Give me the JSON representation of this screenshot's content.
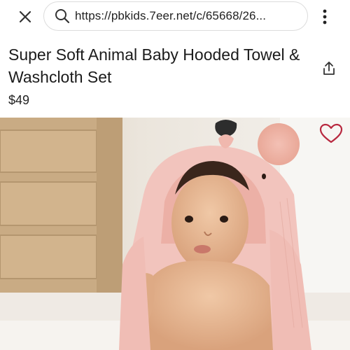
{
  "browser": {
    "url": "https://pbkids.7eer.net/c/65668/26...",
    "icons": {
      "close": "close-icon",
      "search": "search-icon",
      "menu": "more-vertical-icon"
    }
  },
  "product": {
    "title": "Super Soft Animal Baby Hooded Towel & Washcloth Set",
    "price": "$49",
    "icons": {
      "share": "share-icon",
      "favorite": "heart-outline-icon"
    }
  },
  "colors": {
    "accent_heart": "#b8283f",
    "towel_pink": "#f2c4bd",
    "text": "#1b1b1b"
  }
}
